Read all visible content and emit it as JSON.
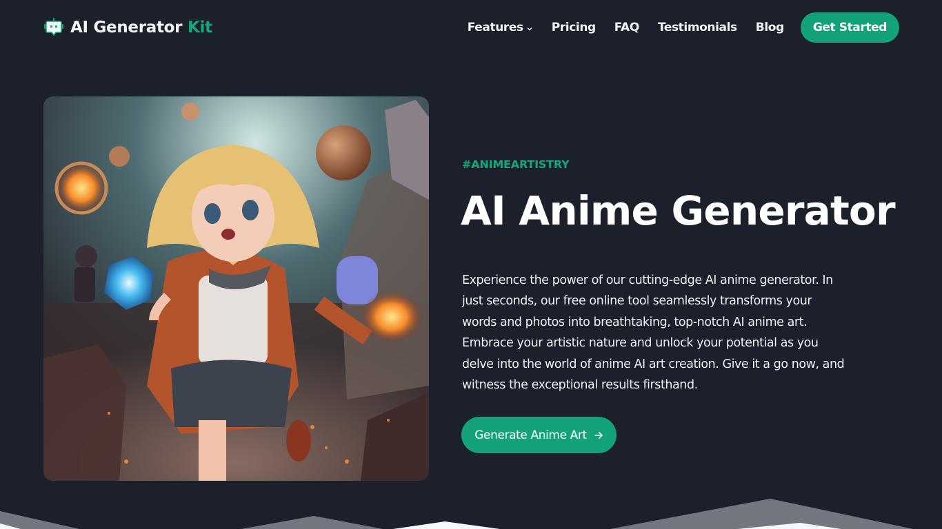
{
  "brand": {
    "name": "AI Generator",
    "accent_word": "Kit",
    "icon": "robot-chat-icon",
    "accent_color": "#17a57c"
  },
  "nav": {
    "items": [
      {
        "label": "Features",
        "has_dropdown": true
      },
      {
        "label": "Pricing"
      },
      {
        "label": "FAQ"
      },
      {
        "label": "Testimonials"
      },
      {
        "label": "Blog"
      }
    ],
    "cta_label": "Get Started"
  },
  "hero": {
    "image_alt": "Anime girl with blonde hair in orange coat holding a glowing blue crystal amid floating orbs and ruins",
    "tag": "#ANIMEARTISTRY",
    "title": "AI Anime Generator",
    "description": "Experience the power of our cutting-edge AI anime generator. In just seconds, our free online tool seamlessly transforms your words and photos into breathtaking, top-notch AI anime art. Embrace your artistic nature and unlock your potential as you delve into the world of anime AI art creation. Give it a go now, and witness the exceptional results firsthand.",
    "cta_label": "Generate Anime Art",
    "cta_icon": "arrow-right-icon"
  },
  "colors": {
    "background": "#1b202b",
    "primary": "#12a37b",
    "mountain_back": "#737780",
    "mountain_front": "#f5f8fb"
  }
}
